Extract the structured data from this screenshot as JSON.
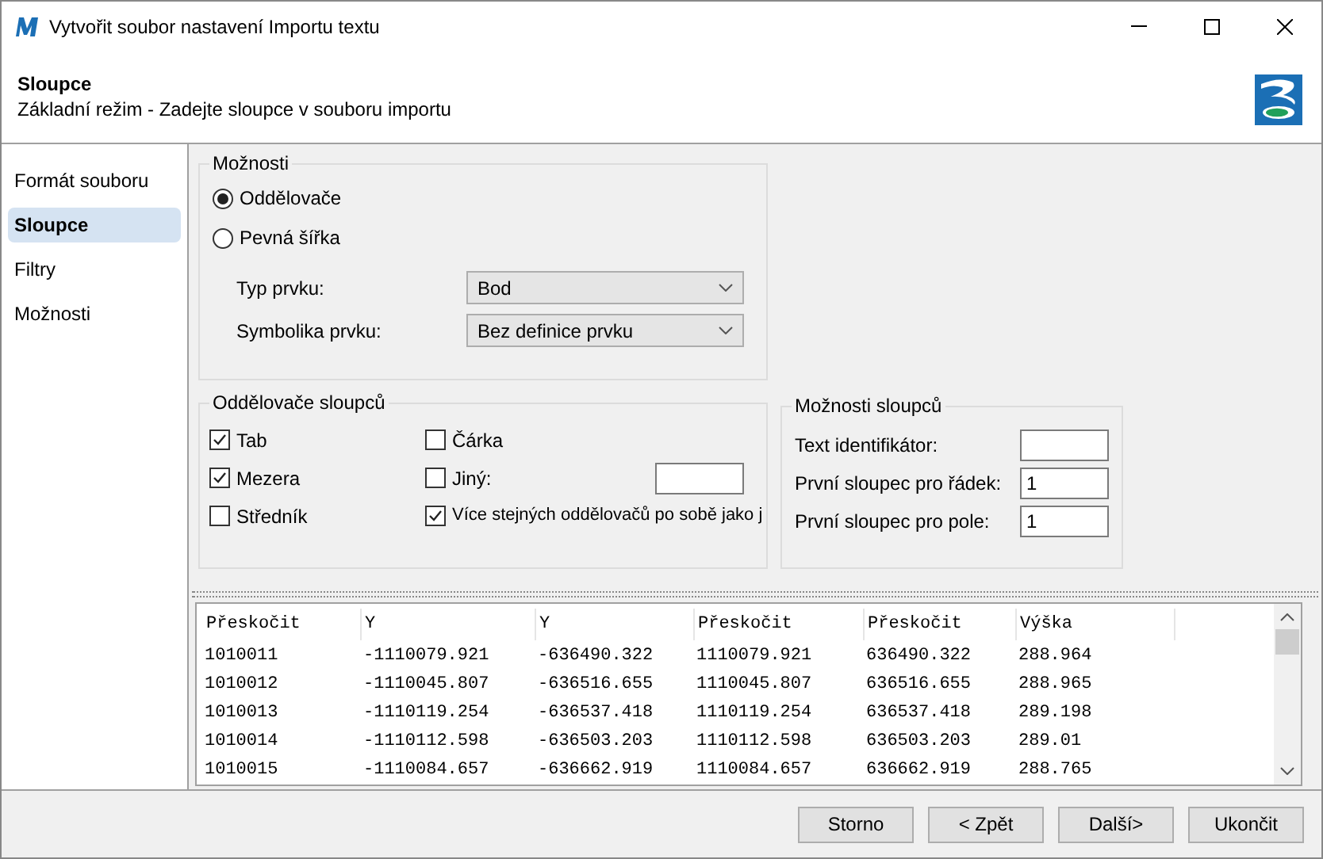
{
  "window": {
    "title": "Vytvořit soubor nastavení Importu textu"
  },
  "header": {
    "title": "Sloupce",
    "subtitle": "Základní režim - Zadejte sloupce v souboru importu"
  },
  "sidebar": {
    "items": [
      {
        "label": "Formát souboru",
        "selected": false
      },
      {
        "label": "Sloupce",
        "selected": true
      },
      {
        "label": "Filtry",
        "selected": false
      },
      {
        "label": "Možnosti",
        "selected": false
      }
    ]
  },
  "options": {
    "title": "Možnosti",
    "radios": [
      {
        "label": "Oddělovače",
        "selected": true
      },
      {
        "label": "Pevná šířka",
        "selected": false
      }
    ],
    "dropdowns": [
      {
        "label": "Typ prvku:",
        "value": "Bod"
      },
      {
        "label": "Symbolika prvku:",
        "value": "Bez definice prvku"
      }
    ]
  },
  "separators": {
    "title": "Oddělovače sloupců",
    "checkboxes": [
      {
        "label": "Tab",
        "checked": true
      },
      {
        "label": "Čárka",
        "checked": false
      },
      {
        "label": "Mezera",
        "checked": true
      },
      {
        "label": "Jiný:",
        "checked": false,
        "has_field": true
      },
      {
        "label": "Středník",
        "checked": false
      },
      {
        "label": "Více stejných oddělovačů po sobě jako j",
        "checked": true
      }
    ]
  },
  "column_options": {
    "title": "Možnosti sloupců",
    "fields": [
      {
        "label": "Text identifikátor:"
      },
      {
        "label": "První sloupec pro řádek:",
        "value": "1"
      },
      {
        "label": "První sloupec pro pole:",
        "value": "1"
      }
    ]
  },
  "preview": {
    "columns": [
      "Přeskočit",
      "Y",
      "Y",
      "Přeskočit",
      "Přeskočit",
      "Výška"
    ],
    "rows": [
      [
        "1010011",
        "-1110079.921",
        "-636490.322",
        "1110079.921",
        "636490.322",
        "288.964"
      ],
      [
        "1010012",
        "-1110045.807",
        "-636516.655",
        "1110045.807",
        "636516.655",
        "288.965"
      ],
      [
        "1010013",
        "-1110119.254",
        "-636537.418",
        "1110119.254",
        "636537.418",
        "289.198"
      ],
      [
        "1010014",
        "-1110112.598",
        "-636503.203",
        "1110112.598",
        "636503.203",
        "289.01"
      ],
      [
        "1010015",
        "-1110084.657",
        "-636662.919",
        "1110084.657",
        "636662.919",
        "288.765"
      ]
    ]
  },
  "buttons": [
    "Storno",
    "< Zpět",
    "Další>",
    "Ukončit"
  ]
}
